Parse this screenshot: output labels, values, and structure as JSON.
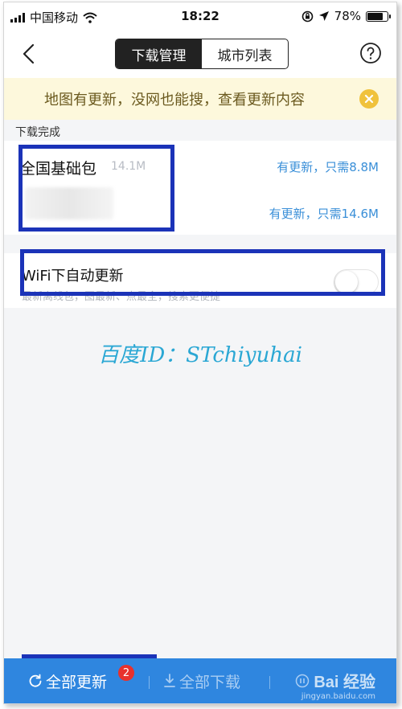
{
  "status_bar": {
    "carrier": "中国移动",
    "time": "18:22",
    "battery": "78%",
    "battery_level": 0.78
  },
  "nav": {
    "tabs": [
      {
        "label": "下载管理",
        "active": true
      },
      {
        "label": "城市列表",
        "active": false
      }
    ]
  },
  "banner": {
    "text": "地图有更新，没网也能搜，查看更新内容"
  },
  "section": {
    "label": "下载完成"
  },
  "package": {
    "name": "全国基础包",
    "size": "14.1M",
    "update_1": "有更新，只需8.8M",
    "update_2": "有更新，只需14.6M"
  },
  "wifi": {
    "title": "WiFi下自动更新",
    "description": "最新离线包，图最新、点最全，搜索更便捷",
    "enabled": false
  },
  "watermark": "百度ID：STchiyuhai",
  "bottom_bar": {
    "update_all": "全部更新",
    "update_badge": "2",
    "download_all": "全部下载",
    "logo": "Bai 经验",
    "logo_sub": "jingyan.baidu.com"
  },
  "colors": {
    "accent": "#2f86df",
    "link": "#3a8fd8",
    "highlight": "#1b33b8",
    "banner_bg": "#fdf8dc"
  }
}
